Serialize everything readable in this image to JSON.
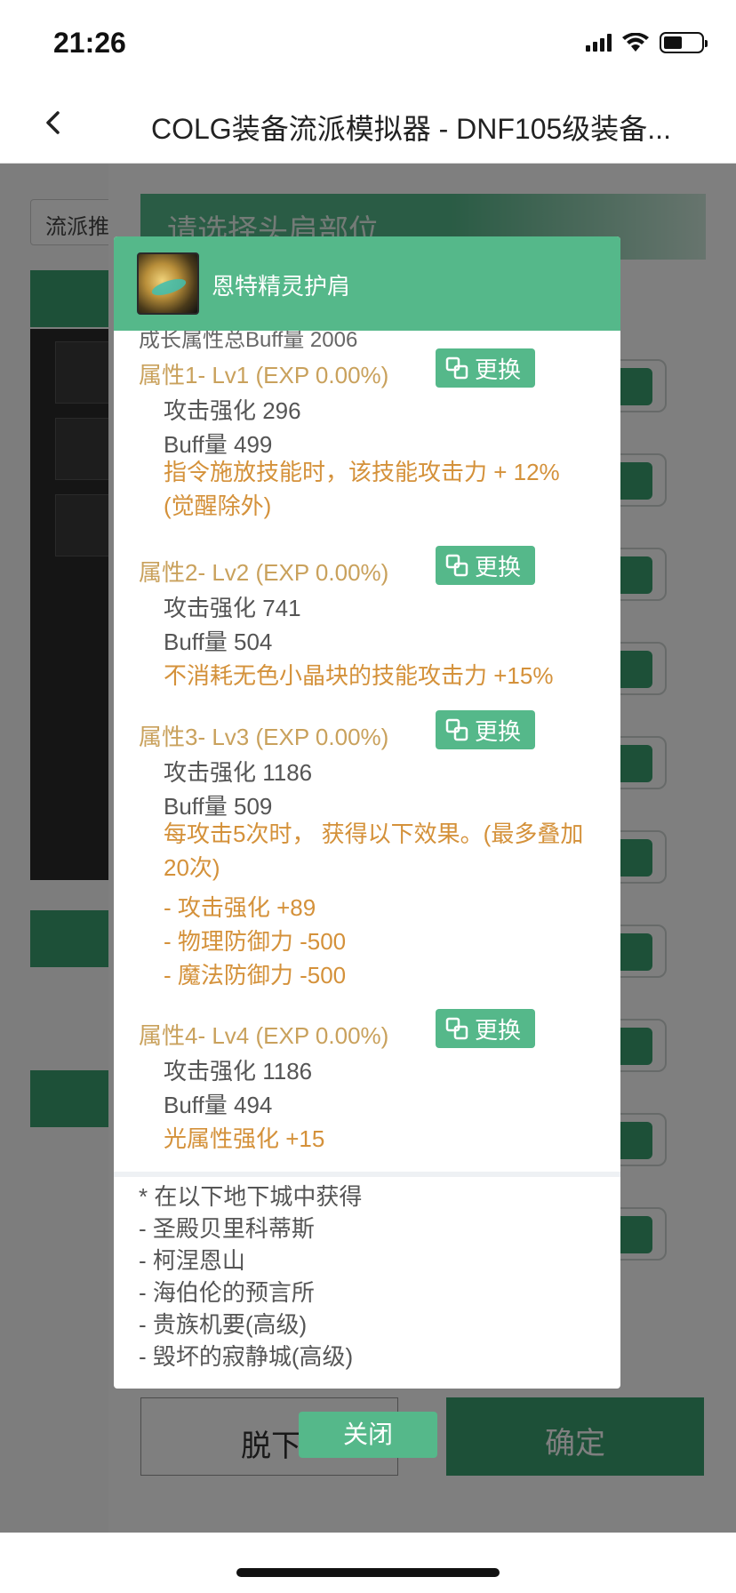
{
  "status_bar": {
    "time": "21:26"
  },
  "nav": {
    "title": "COLG装备流派模拟器 - DNF105级装备..."
  },
  "background": {
    "select_label": "流派推",
    "sheet_header": "请选择头肩部位",
    "cancel_label": "脱下",
    "confirm_label": "确定"
  },
  "modal": {
    "item_name": "恩特精灵护肩",
    "cut_line": "成长属性总Buff量 2006",
    "swap_label": "更换",
    "attributes": [
      {
        "title": "属性1- Lv1 (EXP 0.00%)",
        "lines": [
          "攻击强化 296",
          "Buff量 499"
        ],
        "effects": [
          "指令施放技能时，该技能攻击力 + 12%(觉醒除外)"
        ]
      },
      {
        "title": "属性2- Lv2 (EXP 0.00%)",
        "lines": [
          "攻击强化 741",
          "Buff量 504"
        ],
        "effects": [
          "不消耗无色小晶块的技能攻击力 +15%"
        ]
      },
      {
        "title": "属性3- Lv3 (EXP 0.00%)",
        "lines": [
          "攻击强化 1186",
          "Buff量 509"
        ],
        "effects": [
          "每攻击5次时， 获得以下效果。(最多叠加20次)",
          "- 攻击强化 +89",
          "- 物理防御力 -500",
          "- 魔法防御力 -500"
        ]
      },
      {
        "title": "属性4- Lv4 (EXP 0.00%)",
        "lines": [
          "攻击强化 1186",
          "Buff量 494"
        ],
        "effects": [
          "光属性强化 +15"
        ]
      }
    ],
    "source_title": "* 在以下地下城中获得",
    "sources": [
      "- 圣殿贝里科蒂斯",
      "- 柯涅恩山",
      "- 海伯伦的预言所",
      "- 贵族机要(高级)",
      "- 毁坏的寂静城(高级)"
    ]
  },
  "close_label": "关闭"
}
